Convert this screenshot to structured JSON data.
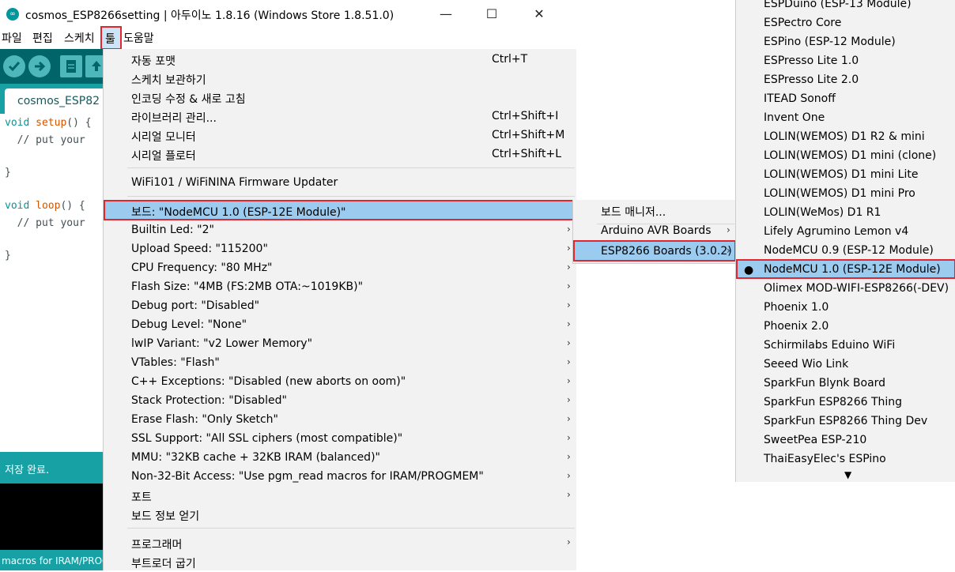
{
  "window": {
    "title": "cosmos_ESP8266setting | 아두이노 1.8.16 (Windows Store 1.8.51.0)",
    "minimize_glyph": "—",
    "maximize_glyph": "☐",
    "close_glyph": "✕",
    "icon_text": "∞"
  },
  "menubar": [
    "파일",
    "편집",
    "스케치",
    "툴",
    "도움말"
  ],
  "editor": {
    "tab_label": "cosmos_ESP82",
    "code": {
      "l1_kw": "void",
      "l1_fn": "setup",
      "l1_rest": "() {",
      "l2": "  // put your",
      "l3": "}",
      "l4_kw": "void",
      "l4_fn": "loop",
      "l4_rest": "() {",
      "l5": "  // put your",
      "l6": "}"
    },
    "status": "저장 완료.",
    "console_line": "macros for IRAM/PROGM"
  },
  "tools_menu": {
    "auto_format": {
      "label": "자동 포맷",
      "shortcut": "Ctrl+T"
    },
    "archive_sketch": {
      "label": "스케치 보관하기"
    },
    "fix_encoding": {
      "label": "인코딩 수정 & 새로 고침"
    },
    "manage_libraries": {
      "label": "라이브러리 관리...",
      "shortcut": "Ctrl+Shift+I"
    },
    "serial_monitor": {
      "label": "시리얼 모니터",
      "shortcut": "Ctrl+Shift+M"
    },
    "serial_plotter": {
      "label": "시리얼 플로터",
      "shortcut": "Ctrl+Shift+L"
    },
    "wifi_updater": {
      "label": "WiFi101 / WiFiNINA Firmware Updater"
    },
    "board": {
      "label": "보드: \"NodeMCU 1.0 (ESP-12E Module)\""
    },
    "options": [
      "Builtin Led: \"2\"",
      "Upload Speed: \"115200\"",
      "CPU Frequency: \"80 MHz\"",
      "Flash Size: \"4MB (FS:2MB OTA:~1019KB)\"",
      "Debug port: \"Disabled\"",
      "Debug Level: \"None\"",
      "lwIP Variant: \"v2 Lower Memory\"",
      "VTables: \"Flash\"",
      "C++ Exceptions: \"Disabled (new aborts on oom)\"",
      "Stack Protection: \"Disabled\"",
      "Erase Flash: \"Only Sketch\"",
      "SSL Support: \"All SSL ciphers (most compatible)\"",
      "MMU: \"32KB cache + 32KB IRAM (balanced)\"",
      "Non-32-Bit Access: \"Use pgm_read macros for IRAM/PROGMEM\"",
      "포트"
    ],
    "board_info": "보드 정보 얻기",
    "programmer": "프로그래머",
    "burn_bootloader": "부트로더 굽기",
    "arrow_glyph": "›"
  },
  "board_submenu": {
    "manager": "보드 매니저...",
    "avr": "Arduino AVR Boards",
    "esp": "ESP8266 Boards (3.0.2)"
  },
  "esp_boards": {
    "items": [
      "ESPDuino (ESP-13 Module)",
      "ESPectro Core",
      "ESPino (ESP-12 Module)",
      "ESPresso Lite 1.0",
      "ESPresso Lite 2.0",
      "ITEAD Sonoff",
      "Invent One",
      "LOLIN(WEMOS) D1 R2 & mini",
      "LOLIN(WEMOS) D1 mini (clone)",
      "LOLIN(WEMOS) D1 mini Lite",
      "LOLIN(WEMOS) D1 mini Pro",
      "LOLIN(WeMos) D1 R1",
      "Lifely Agrumino Lemon v4",
      "NodeMCU 0.9 (ESP-12 Module)",
      "NodeMCU 1.0 (ESP-12E Module)",
      "Olimex MOD-WIFI-ESP8266(-DEV)",
      "Phoenix 1.0",
      "Phoenix 2.0",
      "Schirmilabs Eduino WiFi",
      "Seeed Wio Link",
      "SparkFun Blynk Board",
      "SparkFun ESP8266 Thing",
      "SparkFun ESP8266 Thing Dev",
      "SweetPea ESP-210",
      "ThaiEasyElec's ESPino"
    ],
    "selected_dot": "●",
    "scroll_glyph": "▼"
  }
}
